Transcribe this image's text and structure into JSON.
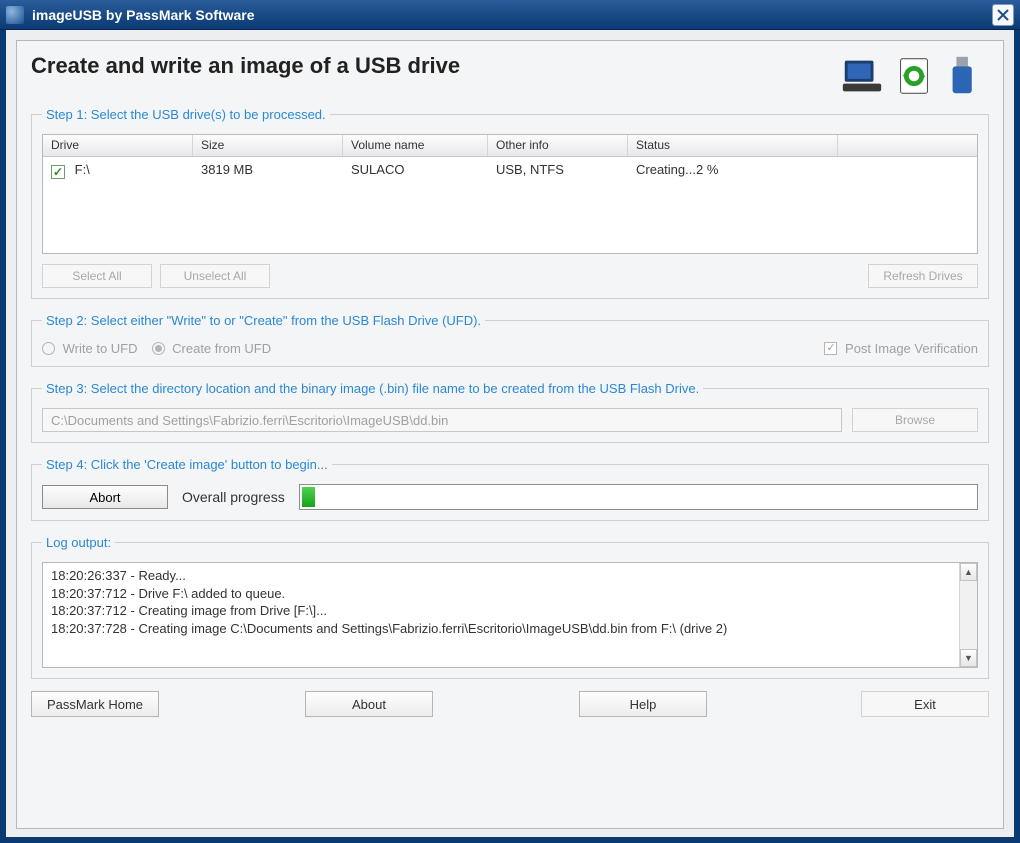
{
  "window": {
    "title": "imageUSB by PassMark Software"
  },
  "heading": "Create and write an image of a USB drive",
  "step1": {
    "legend": "Step 1: Select the USB drive(s) to be processed.",
    "columns": {
      "drive": "Drive",
      "size": "Size",
      "volume": "Volume name",
      "other": "Other info",
      "status": "Status"
    },
    "rows": [
      {
        "checked": true,
        "drive": "F:\\",
        "size": "3819 MB",
        "volume": "SULACO",
        "other": "USB, NTFS",
        "status": "Creating...2 %"
      }
    ],
    "buttons": {
      "select_all": "Select All",
      "unselect_all": "Unselect All",
      "refresh": "Refresh Drives"
    }
  },
  "step2": {
    "legend": "Step 2: Select either \"Write\" to or \"Create\" from the USB Flash Drive (UFD).",
    "write_label": "Write to UFD",
    "create_label": "Create from UFD",
    "post_verify_label": "Post Image Verification"
  },
  "step3": {
    "legend": "Step 3: Select the directory location and the binary image (.bin) file name to be created from the USB Flash Drive.",
    "path": "C:\\Documents and Settings\\Fabrizio.ferri\\Escritorio\\ImageUSB\\dd.bin",
    "browse": "Browse"
  },
  "step4": {
    "legend": "Step 4: Click the 'Create image' button to begin...",
    "abort": "Abort",
    "progress_label": "Overall progress",
    "progress_percent": 2
  },
  "log": {
    "legend": "Log output:",
    "lines": [
      "18:20:26:337 - Ready...",
      "18:20:37:712 - Drive F:\\ added to queue.",
      "18:20:37:712 - Creating image from Drive [F:\\]...",
      "18:20:37:728 - Creating image C:\\Documents and Settings\\Fabrizio.ferri\\Escritorio\\ImageUSB\\dd.bin from F:\\ (drive 2)"
    ]
  },
  "footer": {
    "passmark_home": "PassMark Home",
    "about": "About",
    "help": "Help",
    "exit": "Exit"
  }
}
